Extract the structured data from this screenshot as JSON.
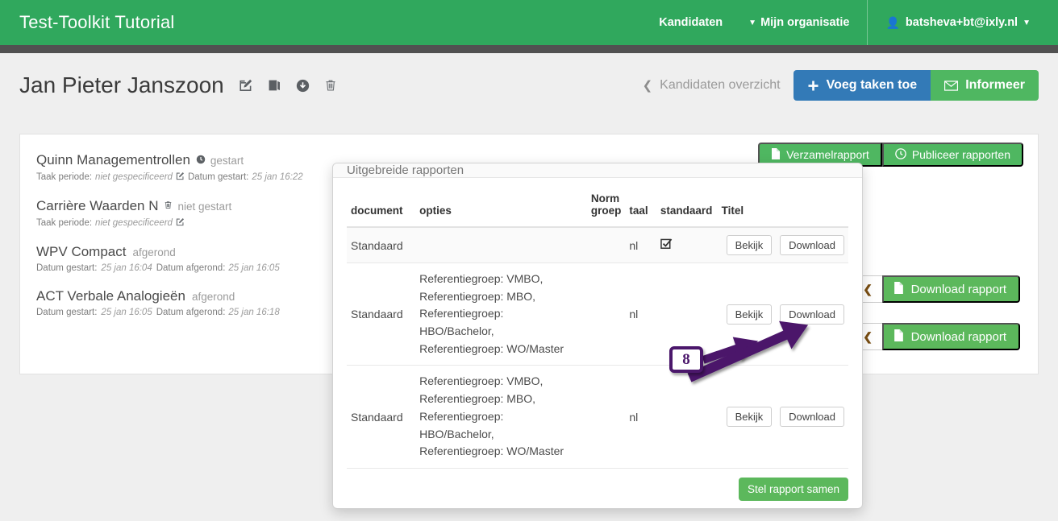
{
  "navbar": {
    "brand": "Test-Toolkit Tutorial",
    "links": [
      {
        "label": "Kandidaten",
        "icon": ""
      },
      {
        "label": "Mijn organisatie",
        "icon": "caret-down-icon"
      }
    ],
    "user": {
      "label": "batsheva+bt@ixly.nl",
      "icon": "user-icon",
      "caret": "caret-down-icon"
    }
  },
  "page": {
    "title": "Jan Pieter Janszoon",
    "title_icons": [
      "edit-icon",
      "copy-icon",
      "download-circle-icon",
      "trash-icon"
    ],
    "back_link": "Kandidaten overzicht",
    "back_icon": "chevron-left-icon",
    "add_tasks_button": "Voeg taken toe",
    "add_tasks_icon": "plus-icon",
    "inform_button": "Informeer",
    "inform_icon": "envelope-icon"
  },
  "card": {
    "collect_report_button": "Verzamelrapport",
    "collect_report_icon": "file-icon",
    "publish_reports_button": "Publiceer rapporten",
    "publish_reports_icon": "clock-icon",
    "download_buttons": [
      {
        "label": "Download rapport",
        "icon": "file-icon",
        "chevron": "chevron-left-icon"
      },
      {
        "label": "Download rapport",
        "icon": "file-icon",
        "chevron": "chevron-left-icon"
      }
    ],
    "tasks": [
      {
        "name": "Quinn Managementrollen",
        "icon": "clock-icon",
        "status": "gestart",
        "meta_prefix": "Taak periode:",
        "meta_value": "niet gespecificeerd",
        "meta_icon": "edit-icon",
        "meta_suffix_label": "Datum gestart:",
        "meta_suffix_value": "25 jan 16:22"
      },
      {
        "name": "Carrière Waarden N",
        "icon": "trash-icon",
        "status": "niet gestart",
        "meta_prefix": "Taak periode:",
        "meta_value": "niet gespecificeerd",
        "meta_icon": "edit-icon",
        "meta_suffix_label": "",
        "meta_suffix_value": ""
      },
      {
        "name": "WPV Compact",
        "icon": "",
        "status": "afgerond",
        "meta_prefix": "Datum gestart:",
        "meta_value": "25 jan 16:04",
        "meta_icon": "",
        "meta_suffix_label": "Datum afgerond:",
        "meta_suffix_value": "25 jan 16:05"
      },
      {
        "name": "ACT Verbale Analogieën",
        "icon": "",
        "status": "afgerond",
        "meta_prefix": "Datum gestart:",
        "meta_value": "25 jan 16:05",
        "meta_icon": "",
        "meta_suffix_label": "Datum afgerond:",
        "meta_suffix_value": "25 jan 16:18"
      }
    ]
  },
  "modal": {
    "title": "Uitgebreide rapporten",
    "columns": [
      "document",
      "opties",
      "Norm groep",
      "taal",
      "standaard",
      "Titel"
    ],
    "rows": [
      {
        "document": "Standaard",
        "opties": "",
        "norm_groep": "",
        "taal": "nl",
        "standaard": "checked-checkbox-icon",
        "titel": "",
        "view_button": "Bekijk",
        "download_button": "Download"
      },
      {
        "document": "Standaard",
        "opties": "Referentiegroep: VMBO,\nReferentiegroep: MBO,\nReferentiegroep: HBO/Bachelor,\nReferentiegroep: WO/Master",
        "norm_groep": "",
        "taal": "nl",
        "standaard": "",
        "titel": "",
        "view_button": "Bekijk",
        "download_button": "Download"
      },
      {
        "document": "Standaard",
        "opties": "Referentiegroep: VMBO,\nReferentiegroep: MBO,\nReferentiegroep: HBO/Bachelor,\nReferentiegroep: WO/Master",
        "norm_groep": "",
        "taal": "nl",
        "standaard": "",
        "titel": "",
        "view_button": "Bekijk",
        "download_button": "Download"
      }
    ],
    "footer_button": "Stel rapport samen"
  },
  "annotation": {
    "step_number": "8",
    "color": "#4b176b"
  },
  "colors": {
    "brand_green": "#30a85d",
    "primary_blue": "#337ab7",
    "success_green": "#5cb85c",
    "dark_bar": "#515151",
    "page_bg": "#efefef"
  }
}
